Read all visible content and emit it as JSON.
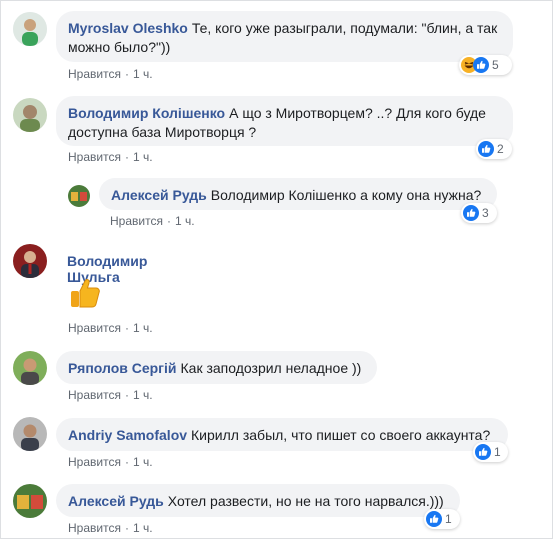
{
  "comments": [
    {
      "author": "Myroslav Oleshko",
      "text": "Те, кого уже разыграли, подумали: \"блин, а так можно было?\"))",
      "like_label": "Нравится",
      "time": "1 ч.",
      "reaction_count": "5",
      "reactions": [
        "haha-icon",
        "like-icon"
      ]
    },
    {
      "author": "Володимир Колішенко",
      "text": "А що з Миротворцем? ..? Для кого буде доступна база Миротворця ?",
      "like_label": "Нравится",
      "time": "1 ч.",
      "reaction_count": "2",
      "reactions": [
        "like-icon"
      ]
    },
    {
      "author": "Алексей Рудь",
      "text": "Володимир Колішенко а кому она нужна?",
      "like_label": "Нравится",
      "time": "1 ч.",
      "reaction_count": "3",
      "reactions": [
        "like-icon"
      ]
    },
    {
      "author": "Володимир Шульга",
      "text": "",
      "sticker": "thumbs-up-sticker-icon",
      "like_label": "Нравится",
      "time": "1 ч."
    },
    {
      "author": "Ряполов Сергій",
      "text": "Как заподозрил неладное ))",
      "like_label": "Нравится",
      "time": "1 ч."
    },
    {
      "author": "Andriy Samofalov",
      "text": "Кирилл забыл, что пишет со своего аккаунта?",
      "like_label": "Нравится",
      "time": "1 ч.",
      "reaction_count": "1",
      "reactions": [
        "like-icon"
      ]
    },
    {
      "author": "Алексей Рудь",
      "text": "Хотел развести, но не на того нарвался.)))",
      "like_label": "Нравится",
      "time": "1 ч.",
      "reaction_count": "1",
      "reactions": [
        "like-icon"
      ]
    }
  ],
  "colors": {
    "author": "#385898",
    "bubble": "#f2f3f5",
    "meta": "#606770",
    "like_blue": "#1877f2",
    "haha_yellow": "#f7b125"
  }
}
